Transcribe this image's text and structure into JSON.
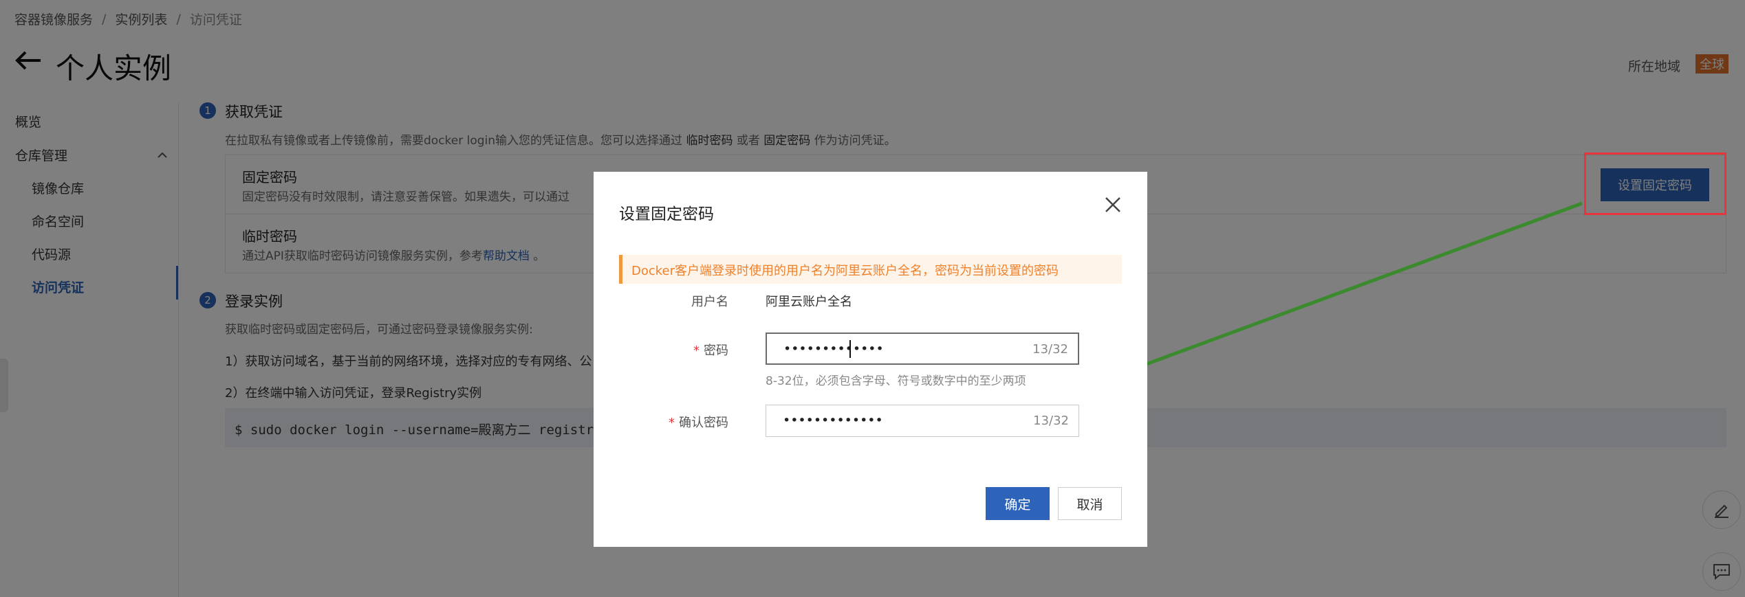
{
  "breadcrumb": {
    "items": [
      "容器镜像服务",
      "实例列表",
      "访问凭证"
    ],
    "separator": "/"
  },
  "header": {
    "title": "个人实例",
    "region_label": "所在地域",
    "region_value": "全球"
  },
  "sidebar": {
    "overview": "概览",
    "repo_group": "仓库管理",
    "items": [
      {
        "label": "镜像仓库"
      },
      {
        "label": "命名空间"
      },
      {
        "label": "代码源"
      },
      {
        "label": "访问凭证",
        "active": true
      }
    ]
  },
  "step1": {
    "number": "1",
    "title": "获取凭证",
    "desc_prefix": "在拉取私有镜像或者上传镜像前，需要docker login输入您的凭证信息。您可以选择通过 ",
    "desc_temp": "临时密码",
    "desc_or": " 或者 ",
    "desc_fixed": "固定密码",
    "desc_suffix": " 作为访问凭证。",
    "fixed_title": "固定密码",
    "fixed_desc": "固定密码没有时效限制，请注意妥善保管。如果遗失，可以通过",
    "set_button": "设置固定密码",
    "temp_title": "临时密码",
    "temp_desc_prefix": "通过API获取临时密码访问镜像服务实例，参考",
    "temp_desc_link": "帮助文档",
    "temp_desc_suffix": " 。"
  },
  "step2": {
    "number": "2",
    "title": "登录实例",
    "desc": "获取临时密码或固定密码后，可通过密码登录镜像服务实例:",
    "line1": "1）获取访问域名，基于当前的网络环境，选择对应的专有网络、公",
    "line2": "2）在终端中输入访问凭证，登录Registry实例",
    "code": "$ sudo docker login --username=殿离方二 registry.c"
  },
  "modal": {
    "title": "设置固定密码",
    "alert": "Docker客户端登录时使用的用户名为阿里云账户全名，密码为当前设置的密码",
    "username_label": "用户名",
    "username_value": "阿里云账户全名",
    "password_label": "密码",
    "password_mask": "•••••••••••••",
    "password_counter": "13/32",
    "password_hint": "8-32位，必须包含字母、符号或数字中的至少两项",
    "confirm_label": "确认密码",
    "confirm_mask": "•••••••••••••",
    "confirm_counter": "13/32",
    "required_mark": "*",
    "ok": "确定",
    "cancel": "取消"
  },
  "colors": {
    "primary": "#2d63b8",
    "alert_text": "#f0812b",
    "alert_bg": "#fef4e9",
    "region_badge": "#e2702a",
    "annotation_red": "#e8343a",
    "annotation_arrow": "#3b8a2e"
  }
}
